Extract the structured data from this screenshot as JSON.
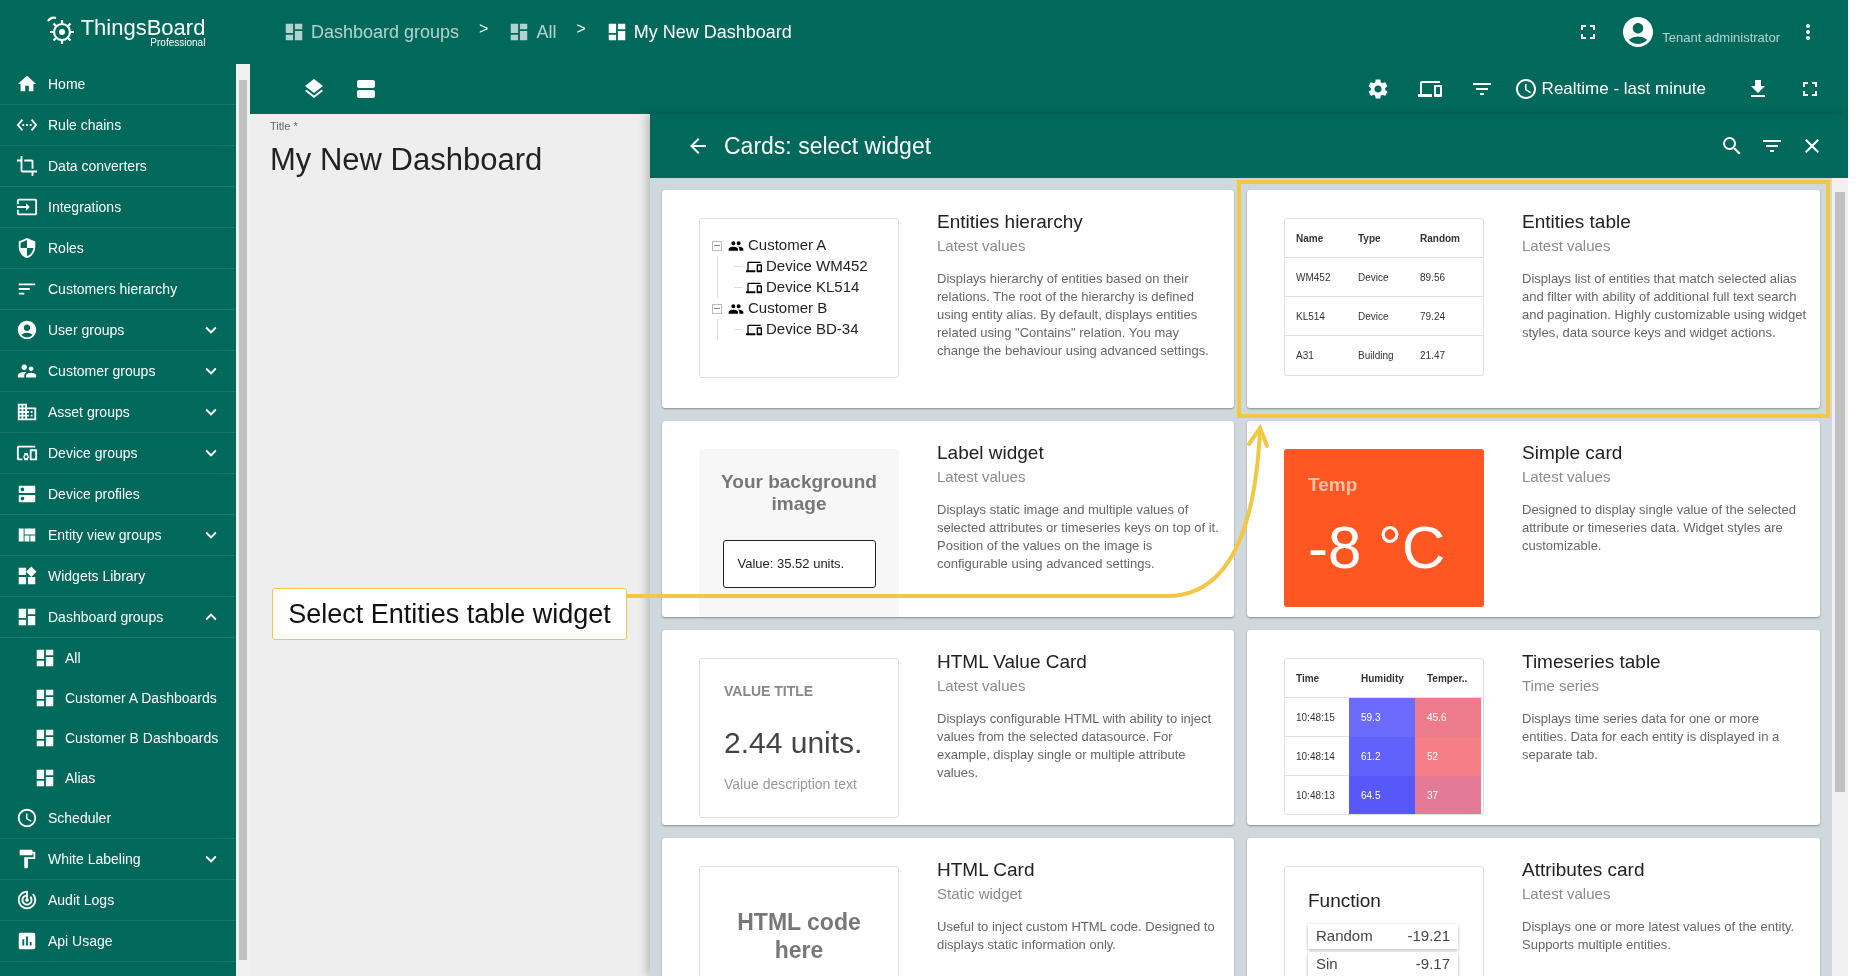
{
  "logo": {
    "name": "ThingsBoard",
    "edition": "Professional"
  },
  "sidebar": {
    "items": [
      {
        "label": "Home"
      },
      {
        "label": "Rule chains"
      },
      {
        "label": "Data converters"
      },
      {
        "label": "Integrations"
      },
      {
        "label": "Roles"
      },
      {
        "label": "Customers hierarchy"
      },
      {
        "label": "User groups",
        "expanded": false
      },
      {
        "label": "Customer groups",
        "expanded": false
      },
      {
        "label": "Asset groups",
        "expanded": false
      },
      {
        "label": "Device groups",
        "expanded": false
      },
      {
        "label": "Device profiles"
      },
      {
        "label": "Entity view groups",
        "expanded": false
      },
      {
        "label": "Widgets Library"
      },
      {
        "label": "Dashboard groups",
        "expanded": true,
        "children": [
          {
            "label": "All"
          },
          {
            "label": "Customer A Dashboards"
          },
          {
            "label": "Customer B Dashboards"
          },
          {
            "label": "Alias"
          }
        ]
      },
      {
        "label": "Scheduler"
      },
      {
        "label": "White Labeling",
        "expanded": false
      },
      {
        "label": "Audit Logs"
      },
      {
        "label": "Api Usage"
      }
    ]
  },
  "breadcrumbs": [
    {
      "label": "Dashboard groups",
      "current": false
    },
    {
      "label": "All",
      "current": false
    },
    {
      "label": "My New Dashboard",
      "current": true
    }
  ],
  "breadcrumb_separators": [
    ">",
    ">"
  ],
  "user": {
    "role": "Tenant administrator"
  },
  "toolbar": {
    "timewindow": "Realtime - last minute"
  },
  "dashboard": {
    "title_label": "Title *",
    "title": "My New Dashboard"
  },
  "widget_panel": {
    "title": "Cards: select widget",
    "cards": [
      {
        "title": "Entities hierarchy",
        "subtitle": "Latest values",
        "description": "Displays hierarchy of entities based on their relations. The root of the hierarchy is defined using entity alias. By default, displays entities related using \"Contains\" relation. You may change the behaviour using advanced settings.",
        "highlighted": false,
        "preview": {
          "kind": "hierarchy",
          "tree": [
            {
              "label": "Customer A",
              "expanded": true,
              "children": [
                {
                  "label": "Device WM452"
                },
                {
                  "label": "Device KL514"
                }
              ]
            },
            {
              "label": "Customer B",
              "expanded": true,
              "children": [
                {
                  "label": "Device BD-34"
                }
              ]
            }
          ]
        }
      },
      {
        "title": "Entities table",
        "subtitle": "Latest values",
        "description": "Displays list of entities that match selected alias and filter with ability of additional full text search and pagination. Highly customizable using widget styles, data source keys and widget actions.",
        "highlighted": true,
        "preview": {
          "kind": "entities_table",
          "columns": [
            "Name",
            "Type",
            "Random"
          ],
          "rows": [
            [
              "WM452",
              "Device",
              "89.56"
            ],
            [
              "KL514",
              "Device",
              "79.24"
            ],
            [
              "A31",
              "Building",
              "21.47"
            ]
          ]
        }
      },
      {
        "title": "Label widget",
        "subtitle": "Latest values",
        "description": "Displays static image and multiple values of selected attributes or timeseries keys on top of it. Position of the values on the image is configurable using advanced settings.",
        "highlighted": false,
        "preview": {
          "kind": "label",
          "background_text": "Your background image",
          "value_text": "Value: 35.52 units."
        }
      },
      {
        "title": "Simple card",
        "subtitle": "Latest values",
        "description": "Designed to display single value of the selected attribute or timeseries data. Widget styles are customizable.",
        "highlighted": false,
        "preview": {
          "kind": "simple_card",
          "label": "Temp",
          "value": "-8 °C"
        }
      },
      {
        "title": "HTML Value Card",
        "subtitle": "Latest values",
        "description": "Displays configurable HTML with ability to inject values from the selected datasource. For example, display single or multiple attribute values.",
        "highlighted": false,
        "preview": {
          "kind": "value_card",
          "title": "VALUE TITLE",
          "value": "2.44 units.",
          "caption": "Value description text"
        }
      },
      {
        "title": "Timeseries table",
        "subtitle": "Time series",
        "description": "Displays time series data for one or more entities. Data for each entity is displayed in a separate tab.",
        "highlighted": false,
        "preview": {
          "kind": "timeseries_table",
          "columns": [
            "Time",
            "Humidity",
            "Temper.."
          ],
          "rows": [
            {
              "cells": [
                {
                  "value": "10:48:15"
                },
                {
                  "value": "59.3",
                  "color": "#6b6bfd"
                },
                {
                  "value": "45.6",
                  "color": "#ec7c8c"
                }
              ]
            },
            {
              "cells": [
                {
                  "value": "10:48:14"
                },
                {
                  "value": "61.2",
                  "color": "#6161fb"
                },
                {
                  "value": "52",
                  "color": "#f57f86"
                }
              ]
            },
            {
              "cells": [
                {
                  "value": "10:48:13"
                },
                {
                  "value": "64.5",
                  "color": "#5757fa"
                },
                {
                  "value": "37",
                  "color": "#e27b96"
                }
              ]
            }
          ]
        }
      },
      {
        "title": "HTML Card",
        "subtitle": "Static widget",
        "description": "Useful to inject custom HTML code. Designed to displays static information only.",
        "highlighted": false,
        "preview": {
          "kind": "html",
          "text": "HTML code here"
        }
      },
      {
        "title": "Attributes card",
        "subtitle": "Latest values",
        "description": "Displays one or more latest values of the entity. Supports multiple entities.",
        "highlighted": false,
        "preview": {
          "kind": "attributes",
          "title": "Function",
          "rows": [
            {
              "name": "Random",
              "value": "-19.21"
            },
            {
              "name": "Sin",
              "value": "-9.17"
            }
          ]
        }
      }
    ]
  },
  "callout": {
    "text": "Select Entities table widget"
  }
}
